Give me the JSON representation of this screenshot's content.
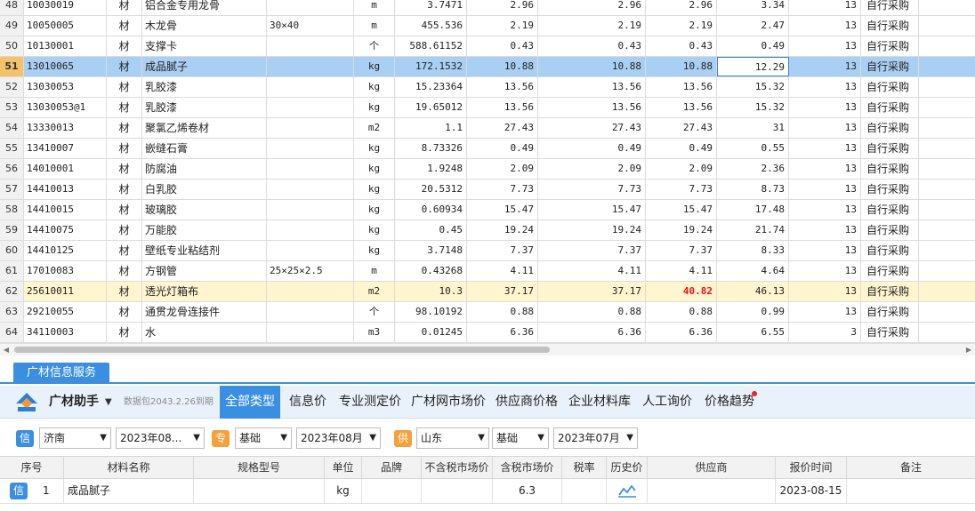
{
  "grid": {
    "rows": [
      {
        "rn": "48",
        "code": "10030019",
        "type": "材",
        "name": "铝合金专用龙骨",
        "spec": "",
        "unit": "m",
        "qty": "3.7471",
        "p1": "2.96",
        "p2": "2.96",
        "p3": "2.96",
        "p4": "3.34",
        "tax": "13",
        "src": "自行采购"
      },
      {
        "rn": "49",
        "code": "10050005",
        "type": "材",
        "name": "木龙骨",
        "spec": "30×40",
        "unit": "m",
        "qty": "455.536",
        "p1": "2.19",
        "p2": "2.19",
        "p3": "2.19",
        "p4": "2.47",
        "tax": "13",
        "src": "自行采购"
      },
      {
        "rn": "50",
        "code": "10130001",
        "type": "材",
        "name": "支撑卡",
        "spec": "",
        "unit": "个",
        "qty": "588.61152",
        "p1": "0.43",
        "p2": "0.43",
        "p3": "0.43",
        "p4": "0.49",
        "tax": "13",
        "src": "自行采购"
      },
      {
        "rn": "51",
        "code": "13010065",
        "type": "材",
        "name": "成品腻子",
        "spec": "",
        "unit": "kg",
        "qty": "172.1532",
        "p1": "10.88",
        "p2": "10.88",
        "p3": "10.88",
        "p4": "12.29",
        "tax": "13",
        "src": "自行采购"
      },
      {
        "rn": "52",
        "code": "13030053",
        "type": "材",
        "name": "乳胶漆",
        "spec": "",
        "unit": "kg",
        "qty": "15.23364",
        "p1": "13.56",
        "p2": "13.56",
        "p3": "13.56",
        "p4": "15.32",
        "tax": "13",
        "src": "自行采购"
      },
      {
        "rn": "53",
        "code": "13030053@1",
        "type": "材",
        "name": "乳胶漆",
        "spec": "",
        "unit": "kg",
        "qty": "19.65012",
        "p1": "13.56",
        "p2": "13.56",
        "p3": "13.56",
        "p4": "15.32",
        "tax": "13",
        "src": "自行采购"
      },
      {
        "rn": "54",
        "code": "13330013",
        "type": "材",
        "name": "聚氯乙烯卷材",
        "spec": "",
        "unit": "m2",
        "qty": "1.1",
        "p1": "27.43",
        "p2": "27.43",
        "p3": "27.43",
        "p4": "31",
        "tax": "13",
        "src": "自行采购"
      },
      {
        "rn": "55",
        "code": "13410007",
        "type": "材",
        "name": "嵌缝石膏",
        "spec": "",
        "unit": "kg",
        "qty": "8.73326",
        "p1": "0.49",
        "p2": "0.49",
        "p3": "0.49",
        "p4": "0.55",
        "tax": "13",
        "src": "自行采购"
      },
      {
        "rn": "56",
        "code": "14010001",
        "type": "材",
        "name": "防腐油",
        "spec": "",
        "unit": "kg",
        "qty": "1.9248",
        "p1": "2.09",
        "p2": "2.09",
        "p3": "2.09",
        "p4": "2.36",
        "tax": "13",
        "src": "自行采购"
      },
      {
        "rn": "57",
        "code": "14410013",
        "type": "材",
        "name": "白乳胶",
        "spec": "",
        "unit": "kg",
        "qty": "20.5312",
        "p1": "7.73",
        "p2": "7.73",
        "p3": "7.73",
        "p4": "8.73",
        "tax": "13",
        "src": "自行采购"
      },
      {
        "rn": "58",
        "code": "14410015",
        "type": "材",
        "name": "玻璃胶",
        "spec": "",
        "unit": "kg",
        "qty": "0.60934",
        "p1": "15.47",
        "p2": "15.47",
        "p3": "15.47",
        "p4": "17.48",
        "tax": "13",
        "src": "自行采购"
      },
      {
        "rn": "59",
        "code": "14410075",
        "type": "材",
        "name": "万能胶",
        "spec": "",
        "unit": "kg",
        "qty": "0.45",
        "p1": "19.24",
        "p2": "19.24",
        "p3": "19.24",
        "p4": "21.74",
        "tax": "13",
        "src": "自行采购"
      },
      {
        "rn": "60",
        "code": "14410125",
        "type": "材",
        "name": "壁纸专业粘结剂",
        "spec": "",
        "unit": "kg",
        "qty": "3.7148",
        "p1": "7.37",
        "p2": "7.37",
        "p3": "7.37",
        "p4": "8.33",
        "tax": "13",
        "src": "自行采购"
      },
      {
        "rn": "61",
        "code": "17010083",
        "type": "材",
        "name": "方钢管",
        "spec": "25×25×2.5",
        "unit": "m",
        "qty": "0.43268",
        "p1": "4.11",
        "p2": "4.11",
        "p3": "4.11",
        "p4": "4.64",
        "tax": "13",
        "src": "自行采购"
      },
      {
        "rn": "62",
        "code": "25610011",
        "type": "材",
        "name": "透光灯箱布",
        "spec": "",
        "unit": "m2",
        "qty": "10.3",
        "p1": "37.17",
        "p2": "37.17",
        "p3": "40.82",
        "p4": "46.13",
        "tax": "13",
        "src": "自行采购"
      },
      {
        "rn": "63",
        "code": "29210055",
        "type": "材",
        "name": "通贯龙骨连接件",
        "spec": "",
        "unit": "个",
        "qty": "98.10192",
        "p1": "0.88",
        "p2": "0.88",
        "p3": "0.88",
        "p4": "0.99",
        "tax": "13",
        "src": "自行采购"
      },
      {
        "rn": "64",
        "code": "34110003",
        "type": "材",
        "name": "水",
        "spec": "",
        "unit": "m3",
        "qty": "0.01245",
        "p1": "6.36",
        "p2": "6.36",
        "p3": "6.36",
        "p4": "6.55",
        "tax": "3",
        "src": "自行采购"
      }
    ]
  },
  "panel": {
    "tab_label": "广材信息服务",
    "assistant_label": "广材助手",
    "package_note": "数据包2043.2.26到期",
    "tabs": [
      "全部类型",
      "信息价",
      "专业测定价",
      "广材网市场价",
      "供应商价格",
      "企业材料库",
      "人工询价",
      "价格趋势"
    ]
  },
  "filters": {
    "badge_info": "信",
    "city1": "济南",
    "date1": "2023年08...",
    "badge_pro": "专",
    "kind1": "基础",
    "date2": "2023年08月",
    "badge_supply": "供",
    "province": "山东",
    "kind2": "基础",
    "date3": "2023年07月"
  },
  "result_table": {
    "headers": [
      "序号",
      "材料名称",
      "规格型号",
      "单位",
      "品牌",
      "不含税市场价",
      "含税市场价",
      "税率",
      "历史价",
      "供应商",
      "报价时间",
      "备注"
    ],
    "row": {
      "badge": "信",
      "index": "1",
      "name": "成品腻子",
      "spec": "",
      "unit": "kg",
      "brand": "",
      "price_excl": "",
      "price_incl": "6.3",
      "tax_rate": "",
      "supplier": "",
      "date": "2023-08-15",
      "note": ""
    }
  },
  "colors": {
    "accent": "#3b8fe0",
    "selection": "#a9cff2",
    "highlight": "#fff6cf",
    "warning_red": "#e11111",
    "badge_orange": "#f5a13a"
  }
}
